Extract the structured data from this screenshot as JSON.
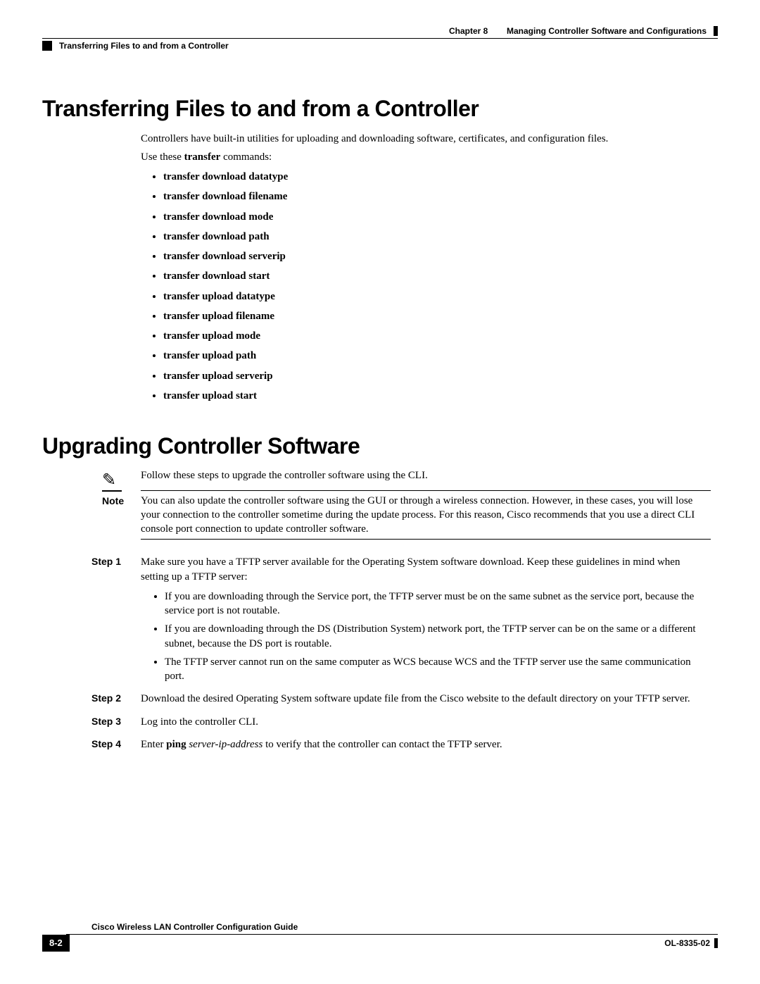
{
  "header": {
    "chapter_label": "Chapter 8",
    "chapter_title": "Managing Controller Software and Configurations",
    "section_title": "Transferring Files to and from a Controller"
  },
  "s1": {
    "heading": "Transferring Files to and from a Controller",
    "intro1": "Controllers have built-in utilities for uploading and downloading software, certificates, and configuration files.",
    "intro2_prefix": "Use these ",
    "intro2_cmd": "transfer",
    "intro2_suffix": " commands:",
    "commands": [
      "transfer download datatype",
      "transfer download filename",
      "transfer download mode",
      "transfer download path",
      "transfer download serverip",
      "transfer download start",
      "transfer upload datatype",
      "transfer upload filename",
      "transfer upload mode",
      "transfer upload path",
      "transfer upload serverip",
      "transfer upload start"
    ]
  },
  "s2": {
    "heading": "Upgrading Controller Software",
    "intro": "Follow these steps to upgrade the controller software using the CLI.",
    "note_label": "Note",
    "note_text": "You can also update the controller software using the GUI or through a wireless connection. However, in these cases, you will lose your connection to the controller sometime during the update process. For this reason, Cisco recommends that you use a direct CLI console port connection to update controller software.",
    "steps": {
      "step1_label": "Step 1",
      "step1_text": "Make sure you have a TFTP server available for the Operating System software download. Keep these guidelines in mind when setting up a TFTP server:",
      "step1_bullets": [
        "If you are downloading through the Service port, the TFTP server must be on the same subnet as the service port, because the service port is not routable.",
        "If you are downloading through the DS (Distribution System) network port, the TFTP server can be on the same or a different subnet, because the DS port is routable.",
        "The TFTP server cannot run on the same computer as WCS because WCS and the TFTP server use the same communication port."
      ],
      "step2_label": "Step 2",
      "step2_text": "Download the desired Operating System software update file from the Cisco website to the default directory on your TFTP server.",
      "step3_label": "Step 3",
      "step3_text": "Log into the controller CLI.",
      "step4_label": "Step 4",
      "step4_prefix": "Enter ",
      "step4_cmd": "ping",
      "step4_arg": "server-ip-address",
      "step4_suffix": " to verify that the controller can contact the TFTP server."
    }
  },
  "footer": {
    "title": "Cisco Wireless LAN Controller Configuration Guide",
    "page": "8-2",
    "doc_id": "OL-8335-02"
  }
}
